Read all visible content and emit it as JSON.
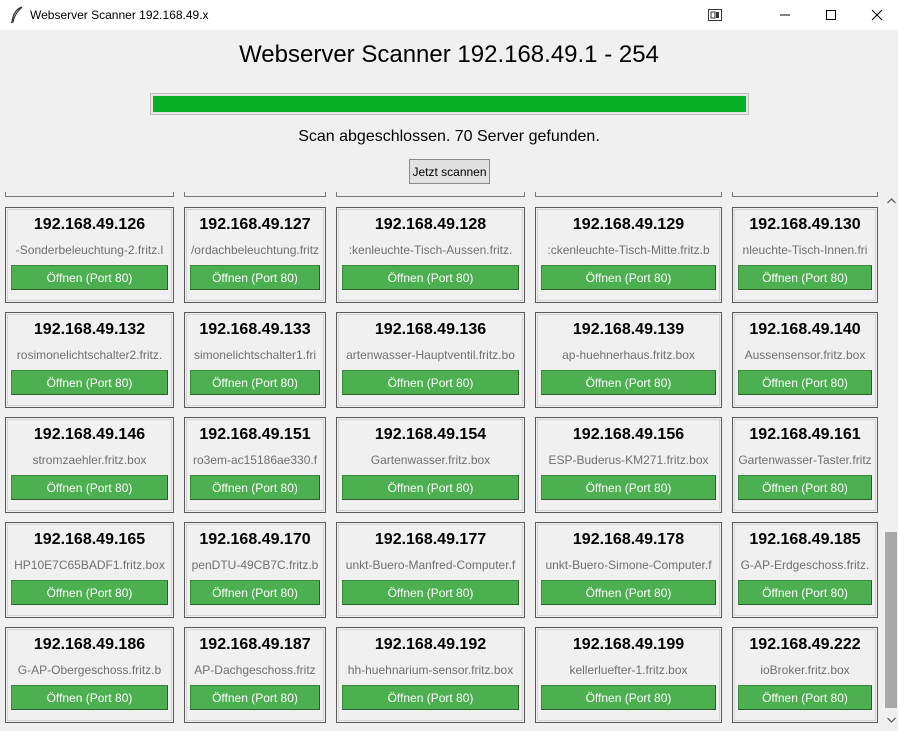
{
  "window": {
    "title": "Webserver Scanner 192.168.49.x",
    "icon": "feather-icon"
  },
  "header": {
    "title": "Webserver Scanner 192.168.49.1 - 254"
  },
  "progress": {
    "value_percent": 100,
    "color": "#06b025"
  },
  "status": {
    "text": "Scan abgeschlossen. 70 Server gefunden."
  },
  "scan_button": {
    "label": "Jetzt scannen"
  },
  "accent": {
    "button_green": "#4caf50"
  },
  "servers": [
    {
      "ip": "192.168.49.126",
      "host": "-Sonderbeleuchtung-2.fritz.l",
      "button": "Öffnen (Port 80)"
    },
    {
      "ip": "192.168.49.127",
      "host": "/ordachbeleuchtung.fritz",
      "button": "Öffnen (Port 80)"
    },
    {
      "ip": "192.168.49.128",
      "host": ":kenleuchte-Tisch-Aussen.fritz.",
      "button": "Öffnen (Port 80)"
    },
    {
      "ip": "192.168.49.129",
      "host": ":ckenleuchte-Tisch-Mitte.fritz.b",
      "button": "Öffnen (Port 80)"
    },
    {
      "ip": "192.168.49.130",
      "host": "nleuchte-Tisch-Innen.fri",
      "button": "Öffnen (Port 80)"
    },
    {
      "ip": "192.168.49.132",
      "host": "rosimonelichtschalter2.fritz.",
      "button": "Öffnen (Port 80)"
    },
    {
      "ip": "192.168.49.133",
      "host": "simonelichtschalter1.fri",
      "button": "Öffnen (Port 80)"
    },
    {
      "ip": "192.168.49.136",
      "host": "artenwasser-Hauptventil.fritz.bo",
      "button": "Öffnen (Port 80)"
    },
    {
      "ip": "192.168.49.139",
      "host": "ap-huehnerhaus.fritz.box",
      "button": "Öffnen (Port 80)"
    },
    {
      "ip": "192.168.49.140",
      "host": "Aussensensor.fritz.box",
      "button": "Öffnen (Port 80)"
    },
    {
      "ip": "192.168.49.146",
      "host": "stromzaehler.fritz.box",
      "button": "Öffnen (Port 80)"
    },
    {
      "ip": "192.168.49.151",
      "host": "ro3em-ac15186ae330.f",
      "button": "Öffnen (Port 80)"
    },
    {
      "ip": "192.168.49.154",
      "host": "Gartenwasser.fritz.box",
      "button": "Öffnen (Port 80)"
    },
    {
      "ip": "192.168.49.156",
      "host": "ESP-Buderus-KM271.fritz.box",
      "button": "Öffnen (Port 80)"
    },
    {
      "ip": "192.168.49.161",
      "host": "Gartenwasser-Taster.fritz",
      "button": "Öffnen (Port 80)"
    },
    {
      "ip": "192.168.49.165",
      "host": "HP10E7C65BADF1.fritz.box",
      "button": "Öffnen (Port 80)"
    },
    {
      "ip": "192.168.49.170",
      "host": "penDTU-49CB7C.fritz.b",
      "button": "Öffnen (Port 80)"
    },
    {
      "ip": "192.168.49.177",
      "host": "unkt-Buero-Manfred-Computer.f",
      "button": "Öffnen (Port 80)"
    },
    {
      "ip": "192.168.49.178",
      "host": "unkt-Buero-Simone-Computer.f",
      "button": "Öffnen (Port 80)"
    },
    {
      "ip": "192.168.49.185",
      "host": "G-AP-Erdgeschoss.fritz.",
      "button": "Öffnen (Port 80)"
    },
    {
      "ip": "192.168.49.186",
      "host": "G-AP-Obergeschoss.fritz.b",
      "button": "Öffnen (Port 80)"
    },
    {
      "ip": "192.168.49.187",
      "host": "AP-Dachgeschoss.fritz",
      "button": "Öffnen (Port 80)"
    },
    {
      "ip": "192.168.49.192",
      "host": "hh-huehnarium-sensor.fritz.box",
      "button": "Öffnen (Port 80)"
    },
    {
      "ip": "192.168.49.199",
      "host": "kellerluefter-1.fritz.box",
      "button": "Öffnen (Port 80)"
    },
    {
      "ip": "192.168.49.222",
      "host": "ioBroker.fritz.box",
      "button": "Öffnen (Port 80)"
    }
  ]
}
